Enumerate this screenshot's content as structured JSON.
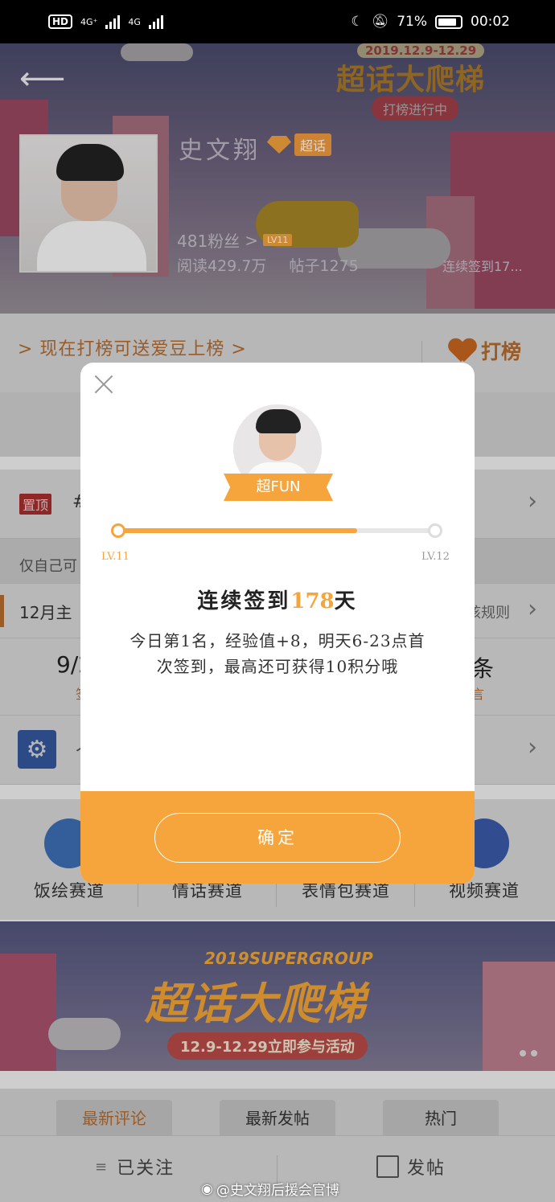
{
  "status_bar": {
    "hd": "HD",
    "net1": "4G⁺",
    "net2": "4G",
    "battery": "71%",
    "time": "00:02"
  },
  "header": {
    "name": "史文翔",
    "chaohua_label": "超话",
    "fans": "481粉丝",
    "level": "LV11",
    "reads": "阅读429.7万",
    "posts": "帖子1275",
    "signed": "连续签到17...",
    "event": {
      "date": "2019.12.9-12.29",
      "title": "超话大爬梯",
      "subtitle": "打榜进行中"
    }
  },
  "rank": {
    "text": "> 现在打榜可送爱豆上榜 >",
    "button": "打榜"
  },
  "list": {
    "pin_tag": "置顶",
    "pin_hash": "#",
    "only_self": "仅自己可",
    "rule_title": "12月主",
    "rule_link": "核规则",
    "task_left": "9/2",
    "task_right": "条",
    "task_left_sub": "签",
    "task_right_sub": "言",
    "setting_label": "个"
  },
  "channels": [
    {
      "label": "饭绘赛道",
      "color": "#3c6fb5"
    },
    {
      "label": "情话赛道",
      "color": "#d88a9e"
    },
    {
      "label": "表情包赛道",
      "color": "#c98d3a"
    },
    {
      "label": "视频赛道",
      "color": "#3a5aa8"
    }
  ],
  "banner": {
    "top": "2019SUPERGROUP",
    "title": "超话大爬梯",
    "sub": "12.9-12.29立即参与活动"
  },
  "tabs": [
    "最新评论",
    "最新发帖",
    "热门"
  ],
  "bottom": {
    "follow": "已关注",
    "post": "发帖"
  },
  "watermark": "@史文翔后援会官博",
  "modal": {
    "ribbon": "超FUN",
    "progress": 0.75,
    "lv_start": "LV.11",
    "lv_end": "LV.12",
    "streak_prefix": "连续签到",
    "streak_days": "178",
    "streak_suffix": "天",
    "desc_line1": "今日第1名，经验值+8，明天6-23点首",
    "desc_line2": "次签到，最高还可获得10积分哦",
    "confirm": "确定"
  },
  "colors": {
    "accent": "#f6a53d",
    "brand_dark": "#b56b2e"
  }
}
